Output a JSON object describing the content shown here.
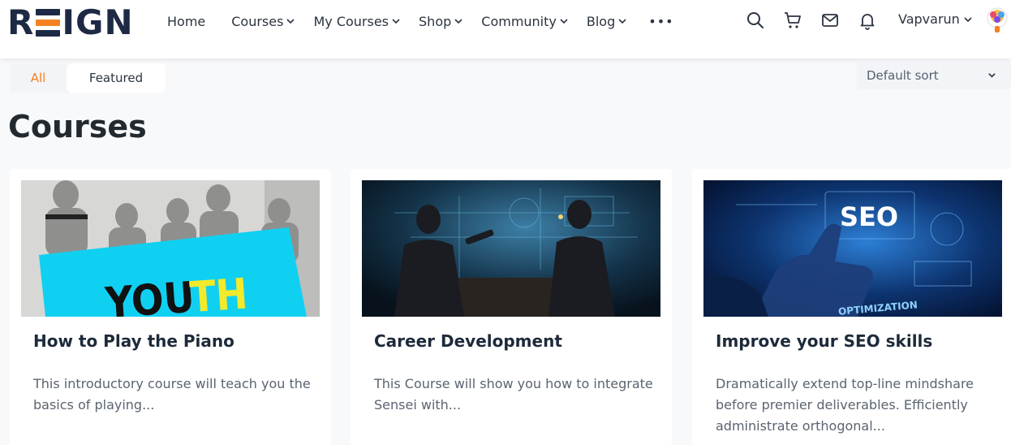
{
  "brand": {
    "logo_left": "R",
    "logo_right": "IGN"
  },
  "nav": {
    "items": [
      {
        "label": "Home",
        "has_dropdown": false
      },
      {
        "label": "Courses",
        "has_dropdown": true
      },
      {
        "label": "My Courses",
        "has_dropdown": true
      },
      {
        "label": "Shop",
        "has_dropdown": true
      },
      {
        "label": "Community",
        "has_dropdown": true
      },
      {
        "label": "Blog",
        "has_dropdown": true
      }
    ],
    "more": "•••"
  },
  "header_icons": [
    "search-icon",
    "cart-icon",
    "mail-icon",
    "bell-icon"
  ],
  "user": {
    "name": "Vapvarun"
  },
  "filters": {
    "tabs": [
      "All",
      "Featured"
    ],
    "active": "All"
  },
  "sort": {
    "selected": "Default sort"
  },
  "page": {
    "title": "Courses"
  },
  "courses": [
    {
      "title": "How to Play the Piano",
      "description": "This introductory course will teach you the basics of playing...",
      "image_text": {
        "you": "YOU",
        "th": "TH"
      }
    },
    {
      "title": "Career Development",
      "description": "This Course will show you how to integrate Sensei with..."
    },
    {
      "title": "Improve your SEO skills",
      "description": "Dramatically extend top-line mindshare before premier deliverables. Efficiently administrate orthogonal...",
      "image_text": {
        "seo": "SEO",
        "optimization": "OPTIMIZATION"
      }
    }
  ],
  "colors": {
    "accent": "#f58220",
    "navy": "#1e2a44",
    "page_bg": "#f8f9fb"
  }
}
